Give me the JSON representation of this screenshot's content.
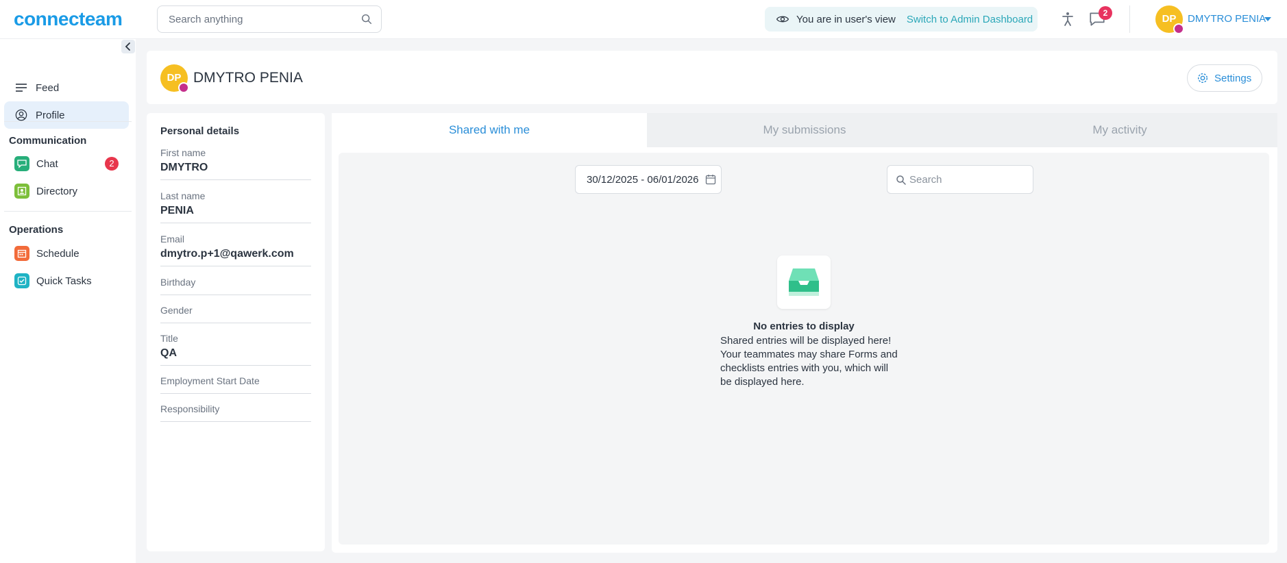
{
  "app": {
    "logo_text": "connecteam"
  },
  "topbar": {
    "search_placeholder": "Search anything",
    "view_notice": "You are in user's view",
    "switch_link": "Switch to Admin Dashboard",
    "chat_badge": "2",
    "user_initials": "DP",
    "user_name": "DMYTRO PENIA"
  },
  "sidebar": {
    "feed": "Feed",
    "profile": "Profile",
    "communication_title": "Communication",
    "chat": "Chat",
    "chat_badge": "2",
    "directory": "Directory",
    "operations_title": "Operations",
    "schedule": "Schedule",
    "quick_tasks": "Quick Tasks"
  },
  "profile": {
    "initials": "DP",
    "name": "DMYTRO PENIA",
    "settings_label": "Settings"
  },
  "details": {
    "title": "Personal details",
    "fields": [
      {
        "label": "First name",
        "value": "DMYTRO"
      },
      {
        "label": "Last name",
        "value": "PENIA"
      },
      {
        "label": "Email",
        "value": "dmytro.p+1@qawerk.com"
      },
      {
        "label": "Birthday",
        "value": ""
      },
      {
        "label": "Gender",
        "value": ""
      },
      {
        "label": "Title",
        "value": "QA"
      },
      {
        "label": "Employment Start Date",
        "value": ""
      },
      {
        "label": "Responsibility",
        "value": ""
      }
    ]
  },
  "tabs": [
    {
      "label": "Shared with me",
      "active": true
    },
    {
      "label": "My submissions",
      "active": false
    },
    {
      "label": "My activity",
      "active": false
    }
  ],
  "filters": {
    "date_range": "30/12/2025 - 06/01/2026",
    "search_placeholder": "Search"
  },
  "empty_state": {
    "title": "No entries to display",
    "line1": "Shared entries will be displayed here!",
    "line2": "Your teammates may share Forms and",
    "line3": "checklists entries with you, which will",
    "line4": "be displayed here."
  },
  "colors": {
    "brand": "#1a9be6",
    "link": "#2a8ed8",
    "badge": "#e8364c",
    "avatar": "#f6bf22",
    "crown": "#c42f8c"
  },
  "icons": [
    "search-icon",
    "eye-icon",
    "accessibility-icon",
    "chat-icon",
    "chevron-down-icon",
    "chevron-left-icon",
    "feed-icon",
    "profile-icon",
    "chat-app-icon",
    "directory-app-icon",
    "schedule-app-icon",
    "quick-tasks-app-icon",
    "gear-icon",
    "calendar-icon",
    "inbox-icon"
  ]
}
